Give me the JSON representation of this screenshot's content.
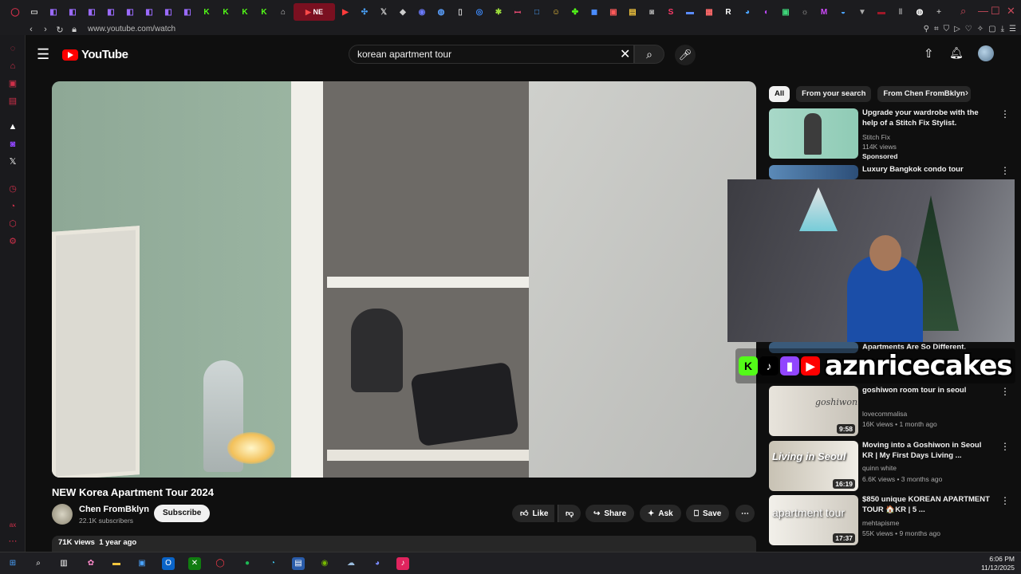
{
  "browser": {
    "tabs": [
      "NE"
    ],
    "url": "www.youtube.com/watch"
  },
  "youtube": {
    "logo_text": "YouTube",
    "search_value": "korean apartment tour"
  },
  "video": {
    "title": "NEW Korea Apartment Tour 2024",
    "channel": "Chen FromBklyn",
    "subscribers": "22.1K subscribers",
    "subscribe_label": "Subscribe",
    "actions": {
      "like": "Like",
      "share": "Share",
      "ask": "Ask",
      "save": "Save"
    },
    "views": "71K views",
    "age": "1 year ago"
  },
  "chips": [
    "All",
    "From your search",
    "From Chen FromBklyn"
  ],
  "recommendations": [
    {
      "title": "Upgrade your wardrobe with the help of a Stitch Fix Stylist.",
      "channel": "Stitch Fix",
      "meta": "114K views",
      "badge": "Sponsored"
    },
    {
      "title": "Luxury Bangkok condo tour",
      "channel": "",
      "meta": ""
    },
    {
      "title": "Apartments Are So Different.",
      "channel": "",
      "meta": ""
    },
    {
      "title": "goshiwon room tour in seoul",
      "channel": "lovecommalisa",
      "meta": "16K views • 1 month ago",
      "duration": "9:58"
    },
    {
      "title": "Moving into a Goshiwon in Seoul KR | My First Days Living ...",
      "channel": "quinn white",
      "meta": "6.6K views • 3 months ago",
      "duration": "16:19"
    },
    {
      "title": "$850 unique KOREAN APARTMENT TOUR 🏠KR | 5 ...",
      "channel": "mehtapisme",
      "meta": "55K views • 9 months ago",
      "duration": "17:37"
    }
  ],
  "overlay": {
    "handle": "aznricecakes"
  },
  "taskbar": {
    "time": "6:06 PM",
    "date": "11/12/2025"
  },
  "colors": {
    "youtube_red": "#ff0000",
    "opera_red": "#d0304a",
    "background": "#0f0f0f"
  }
}
